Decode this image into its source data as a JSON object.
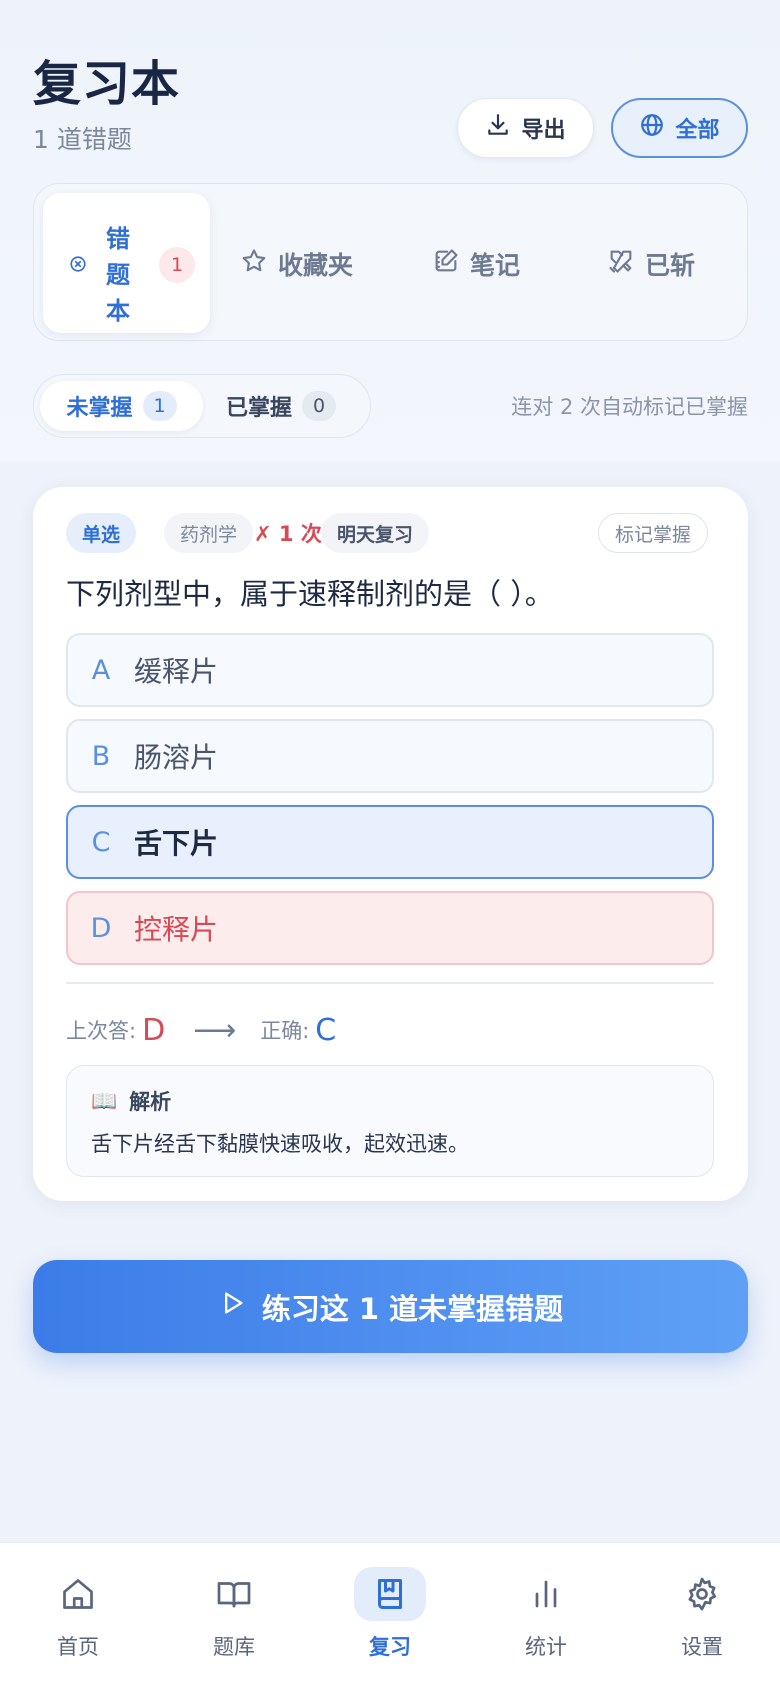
{
  "header": {
    "title": "复习本",
    "subtitle": "1 道错题",
    "export_label": "导出",
    "scope_label": "全部"
  },
  "categories": {
    "active": {
      "chars": [
        "错",
        "题",
        "本"
      ],
      "count": "1"
    },
    "items": [
      {
        "label": "收藏夹",
        "icon": "star-icon"
      },
      {
        "label": "笔记",
        "icon": "note-edit-icon"
      },
      {
        "label": "已斩",
        "icon": "swords-icon"
      }
    ]
  },
  "subtabs": {
    "unmastered_label": "未掌握",
    "unmastered_count": "1",
    "mastered_label": "已掌握",
    "mastered_count": "0",
    "hint": "连对 2 次自动标记已掌握"
  },
  "card": {
    "type_tag": "单选",
    "subject_tag": "药剂学",
    "wrong_tag": "✗ 1 次",
    "due_tag": "明天复习",
    "mark_label": "标记掌握",
    "question": "下列剂型中，属于速释制剂的是（ ）。",
    "options": [
      {
        "letter": "A",
        "text": "缓释片"
      },
      {
        "letter": "B",
        "text": "肠溶片"
      },
      {
        "letter": "C",
        "text": "舌下片"
      },
      {
        "letter": "D",
        "text": "控释片"
      }
    ],
    "last_answer_label": "上次答:",
    "last_answer": "D",
    "arrow": "⟶",
    "correct_label": "正确:",
    "correct_answer": "C",
    "explain_icon": "📖",
    "explain_title": "解析",
    "explain_body": "舌下片经舌下黏膜快速吸收，起效迅速。"
  },
  "cta": {
    "label": "练习这 1 道未掌握错题"
  },
  "nav": {
    "items": [
      {
        "label": "首页",
        "icon": "home-icon"
      },
      {
        "label": "题库",
        "icon": "book-open-icon"
      },
      {
        "label": "复习",
        "icon": "bookmark-book-icon",
        "active": true
      },
      {
        "label": "统计",
        "icon": "bar-chart-icon"
      },
      {
        "label": "设置",
        "icon": "gear-icon"
      }
    ]
  },
  "colors": {
    "accent": "#2f6fd6",
    "danger": "#d64a56",
    "cta_start": "#3c7ce8",
    "cta_end": "#5fa0f6"
  }
}
